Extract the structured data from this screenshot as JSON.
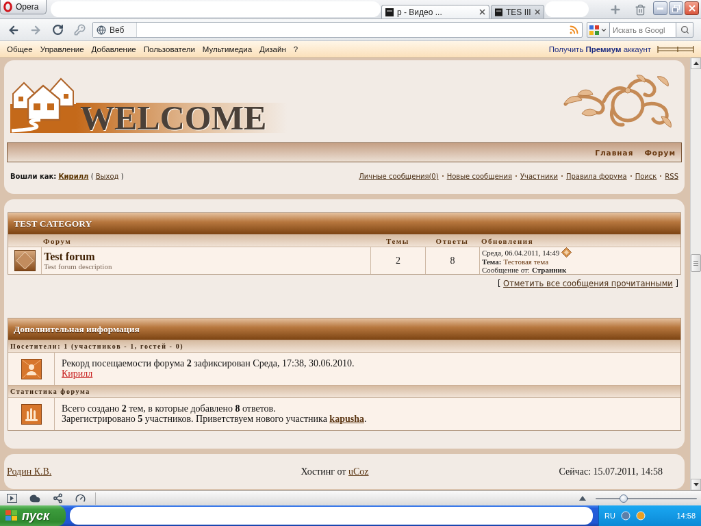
{
  "browser": {
    "menu_button": "Opera",
    "tabs": [
      {
        "label": "р - Видео ...",
        "selected": true
      },
      {
        "label": "TES III",
        "selected": false
      }
    ],
    "address": {
      "badge": "Веб"
    },
    "search": {
      "placeholder": "Искать в Googl"
    }
  },
  "opera_menu": {
    "items": [
      "Общее",
      "Управление",
      "Добавление",
      "Пользователи",
      "Мультимедиа",
      "Дизайн",
      "?"
    ],
    "premium": "Получить **Премиум** аккаунт"
  },
  "site": {
    "logo": "WELCOME",
    "nav": [
      "Главная",
      "Форум"
    ],
    "login": {
      "label": "Вошли как:",
      "user": "Кирилл",
      "open": "(",
      "logout": "Выход",
      "close": ")"
    },
    "user_links": [
      "Личные сообщения(0)",
      "Новые сообщения",
      "Участники",
      "Правила форума",
      "Поиск",
      "RSS"
    ]
  },
  "forum_table": {
    "category": "TEST CATEGORY",
    "columns": [
      "Форум",
      "Темы",
      "Ответы",
      "Обновления"
    ],
    "rows": [
      {
        "name": "Test forum",
        "description": "Test forum description",
        "topics": "2",
        "replies": "8",
        "updated": "Среда, 06.04.2011, 14:49",
        "topic_label": "Тема:",
        "topic": "Тестовая тема",
        "author_label": "Сообщение от:",
        "author": "Странник"
      }
    ]
  },
  "mark_read": {
    "open": "[",
    "link": "Отметить все сообщения прочитанными",
    "close": "]"
  },
  "info": {
    "title": "Дополнительная информация",
    "sections": [
      {
        "kind": "visitors",
        "heading": "Посетители: 1 (участников - 1, гостей - 0)",
        "lines": [
          [
            {
              "text": "Рекорд посещаемости форума **2** зафиксирован Среда, 17:38, 30.06.2010."
            }
          ],
          [
            {
              "link": "Кирилл",
              "kind": "group"
            }
          ]
        ]
      },
      {
        "kind": "stats",
        "heading": "Статистика форума",
        "lines": [
          [
            {
              "text": "Всего создано **2** тем, в которые добавлено **8** ответов."
            }
          ],
          [
            {
              "text": "Зарегистрировано **5** участников. Приветствуем нового участника "
            },
            {
              "link": "kapusha",
              "kind": "member"
            },
            {
              "text": "."
            }
          ]
        ]
      }
    ]
  },
  "footer": {
    "author": "Родин К.В.",
    "hosting": "Хостинг от",
    "hosting_link": "uCoz",
    "now": "Сейчас: 15.07.2011, 14:58"
  },
  "status_bar": {
    "zoom_slider": {
      "level": 0.28
    }
  },
  "taskbar": {
    "start": "пуск",
    "language": "RU",
    "clock": "14:58"
  }
}
